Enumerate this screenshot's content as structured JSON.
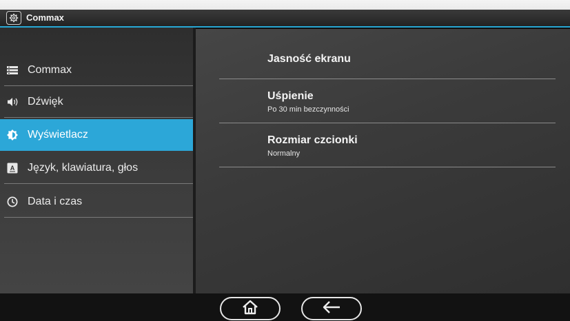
{
  "window": {
    "title": "Commax"
  },
  "sidebar": {
    "items": [
      {
        "label": "Commax",
        "icon": "list-icon",
        "active": false
      },
      {
        "label": "Dźwięk",
        "icon": "speaker-icon",
        "active": false
      },
      {
        "label": "Wyświetlacz",
        "icon": "brightness-icon",
        "active": true
      },
      {
        "label": "Język, klawiatura, głos",
        "icon": "keyboard-language-icon",
        "active": false
      },
      {
        "label": "Data i czas",
        "icon": "clock-icon",
        "active": false
      }
    ]
  },
  "main": {
    "settings": [
      {
        "title": "Jasność ekranu",
        "subtitle": ""
      },
      {
        "title": "Uśpienie",
        "subtitle": "Po 30 min bezczynności"
      },
      {
        "title": "Rozmiar czcionki",
        "subtitle": "Normalny"
      }
    ]
  },
  "navbar": {
    "home_icon": "home-icon",
    "back_icon": "back-arrow-icon"
  },
  "colors": {
    "accent": "#2ca7d8",
    "sidebar_bg": "#3a3a3a",
    "main_bg": "#3b3b3b",
    "titlebar_bg": "#2a2a2a",
    "text": "#f2f2f2"
  }
}
